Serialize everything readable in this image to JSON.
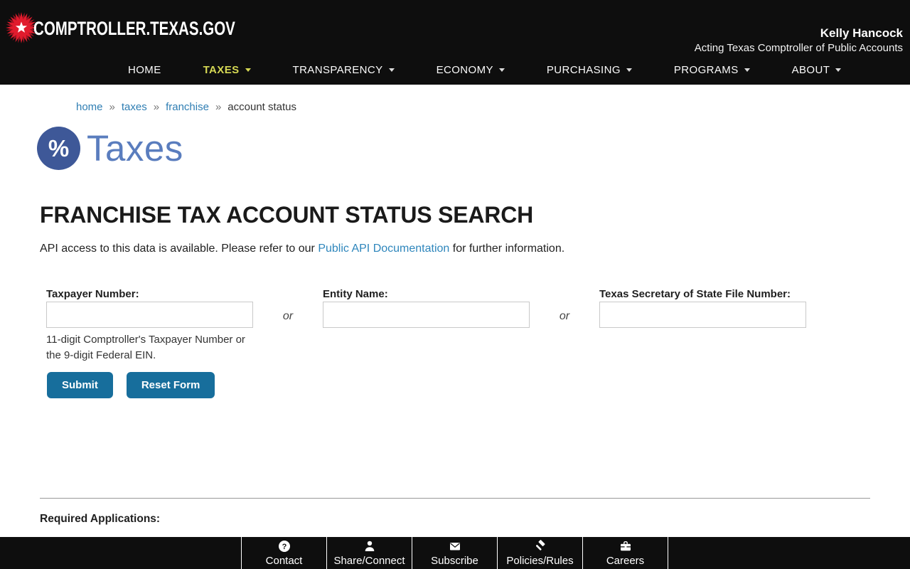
{
  "header": {
    "site_name": "COMPTROLLER.TEXAS.GOV",
    "official": {
      "name": "Kelly Hancock",
      "title": "Acting Texas Comptroller of Public Accounts"
    },
    "nav": [
      {
        "label": "HOME",
        "active": false,
        "has_dropdown": false
      },
      {
        "label": "TAXES",
        "active": true,
        "has_dropdown": true
      },
      {
        "label": "TRANSPARENCY",
        "active": false,
        "has_dropdown": true
      },
      {
        "label": "ECONOMY",
        "active": false,
        "has_dropdown": true
      },
      {
        "label": "PURCHASING",
        "active": false,
        "has_dropdown": true
      },
      {
        "label": "PROGRAMS",
        "active": false,
        "has_dropdown": true
      },
      {
        "label": "ABOUT",
        "active": false,
        "has_dropdown": true
      }
    ]
  },
  "breadcrumb": {
    "separator": "»",
    "items": [
      {
        "label": "home",
        "is_link": true
      },
      {
        "label": "taxes",
        "is_link": true
      },
      {
        "label": "franchise",
        "is_link": true
      },
      {
        "label": "account status",
        "is_link": false
      }
    ]
  },
  "section": {
    "icon": "percent-icon",
    "title": "Taxes"
  },
  "main": {
    "heading": "FRANCHISE TAX ACCOUNT STATUS SEARCH",
    "api_text_before": "API access to this data is available. Please refer to our ",
    "api_link_label": "Public API Documentation",
    "api_text_after": " for further information.",
    "form": {
      "or_text": "or",
      "fields": [
        {
          "label": "Taxpayer Number:",
          "value": "",
          "help": "11-digit Comptroller's Taxpayer Number or the 9-digit Federal EIN."
        },
        {
          "label": "Entity Name:",
          "value": ""
        },
        {
          "label": "Texas Secretary of State File Number:",
          "value": ""
        }
      ],
      "submit_label": "Submit",
      "reset_label": "Reset Form"
    },
    "required_apps_heading": "Required Applications:"
  },
  "footer": {
    "items": [
      {
        "label": "Contact",
        "icon": "question-circle-icon"
      },
      {
        "label": "Share/Connect",
        "icon": "person-icon"
      },
      {
        "label": "Subscribe",
        "icon": "envelope-icon"
      },
      {
        "label": "Policies/Rules",
        "icon": "gavel-icon"
      },
      {
        "label": "Careers",
        "icon": "briefcase-icon"
      }
    ]
  },
  "colors": {
    "header_bg": "#0e0e0e",
    "nav_active": "#d6d954",
    "link_blue": "#2f7eb3",
    "button_blue": "#176e9c",
    "section_circle": "#3e5898",
    "section_title": "#5a7dbe",
    "logo_red": "#e11b2d"
  }
}
